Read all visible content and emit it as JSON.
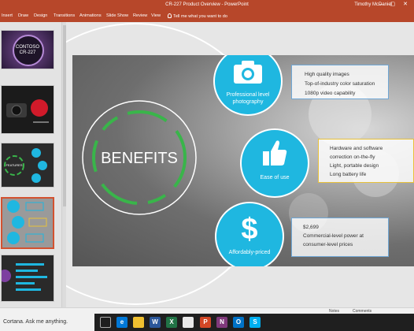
{
  "titlebar": {
    "doc_title": "CR-227 Product Overview - PowerPoint",
    "user_name": "Timothy McDaniel"
  },
  "ribbon": {
    "tabs": [
      "Insert",
      "Draw",
      "Design",
      "Transitions",
      "Animations",
      "Slide Show",
      "Review",
      "View"
    ],
    "tell_me": "Tell me what you want to do"
  },
  "thumbnails": {
    "slide1": {
      "title": "CONTOSO",
      "subtitle": "CR-227"
    },
    "slide3": {
      "label": "FEATURES"
    }
  },
  "slide": {
    "center_title": "BENEFITS",
    "benefits": [
      {
        "caption_lines": [
          "Professional level",
          "photography"
        ],
        "icon": "camera-icon",
        "details": [
          "High quality images",
          "Top-of-industry color saturation",
          "1080p video capability"
        ]
      },
      {
        "caption_lines": [
          "Ease of use"
        ],
        "icon": "thumbs-up-icon",
        "details": [
          "Hardware and software",
          "correction on-the-fly",
          "Light, portable design",
          "Long battery life"
        ]
      },
      {
        "caption_lines": [
          "Affordably-priced"
        ],
        "icon": "dollar-icon",
        "details": [
          "$2,699",
          "Commercial-level power at",
          "consumer-level prices"
        ]
      }
    ]
  },
  "statusbar": {
    "notes_label": "Notes",
    "comments_label": "Comments"
  },
  "taskbar": {
    "search_text": "Cortana. Ask me anything."
  },
  "colors": {
    "accent": "#b7472a",
    "circle": "#1fb7e0",
    "ring": "#39b54a",
    "selection": "#d35230"
  }
}
